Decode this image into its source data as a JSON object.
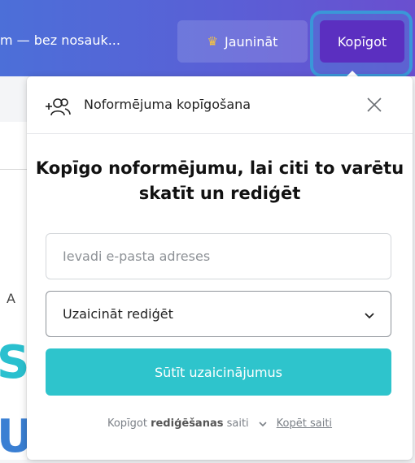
{
  "topbar": {
    "doc_title": "m — bez nosauk...",
    "upgrade_label": "Jaunināt",
    "share_label": "Kopīgot"
  },
  "background": {
    "text_at": "A",
    "big_letter_1": "S",
    "big_letter_2": "U"
  },
  "popup": {
    "header_title": "Noformējuma kopīgošana",
    "heading": "Kopīgo noformējumu, lai citi to varētu skatīt un rediģēt",
    "email_placeholder": "Ievadi e-pasta adreses",
    "permission_value": "Uzaicināt rediģēt",
    "send_label": "Sūtīt uzaicinājumus",
    "footer": {
      "prefix": "Kopīgot",
      "bold": "rediģēšanas",
      "suffix": "saiti",
      "copy_link": "Kopēt saiti"
    }
  },
  "colors": {
    "topbar_start": "#4c6fd8",
    "topbar_end": "#6a4fcf",
    "share_button": "#5b2fc0",
    "focus_ring": "#3a97d8",
    "send_button": "#2ec4cc",
    "crown": "#f5c342"
  },
  "icons": {
    "header_icon": "add-people-icon",
    "close": "close-icon",
    "select_chevron": "chevron-down-icon",
    "footer_chevron": "chevron-down-icon",
    "upgrade": "crown-icon"
  }
}
